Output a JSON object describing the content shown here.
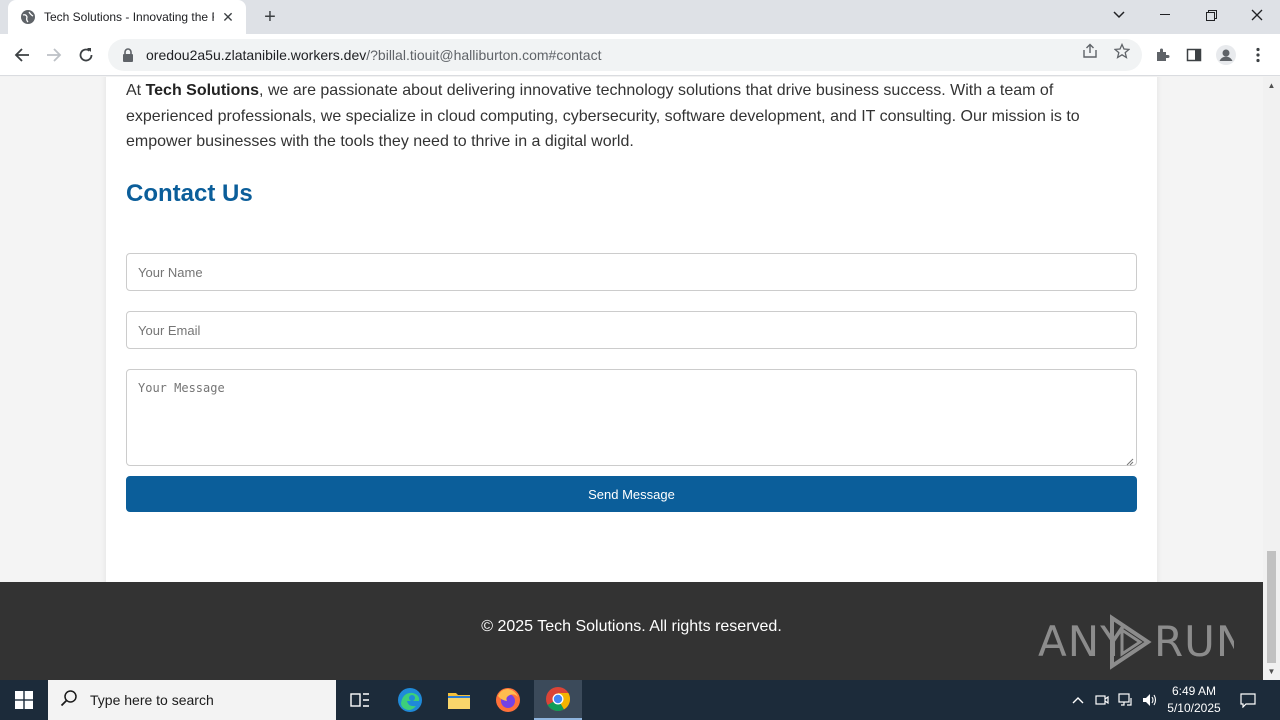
{
  "browser": {
    "tab_title": "Tech Solutions - Innovating the F",
    "url_host": "oredou2a5u.zlatanibile.workers.dev",
    "url_rest": "/?billal.tiouit@halliburton.com#contact"
  },
  "page": {
    "about": {
      "prefix": "At ",
      "brand": "Tech Solutions",
      "text": ", we are passionate about delivering innovative technology solutions that drive business success. With a team of experienced professionals, we specialize in cloud computing, cybersecurity, software development, and IT consulting. Our mission is to empower businesses with the tools they need to thrive in a digital world."
    },
    "contact": {
      "title": "Contact Us",
      "name_placeholder": "Your Name",
      "email_placeholder": "Your Email",
      "message_placeholder": "Your Message",
      "send_label": "Send Message"
    },
    "footer": {
      "copyright": "© 2025 Tech Solutions. All rights reserved."
    },
    "watermark": "ANY RUN"
  },
  "taskbar": {
    "search_placeholder": "Type here to search",
    "time": "6:49 AM",
    "date": "5/10/2025"
  },
  "colors": {
    "accent": "#0b5e9a",
    "footer_bg": "#333333",
    "taskbar_bg": "#1c2b3a"
  }
}
